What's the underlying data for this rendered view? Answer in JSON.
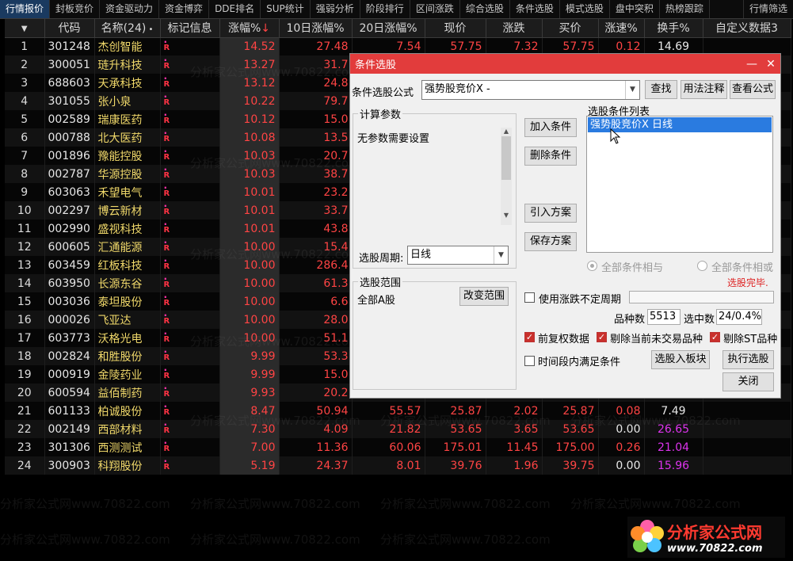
{
  "tabs": [
    "行情报价",
    "封板竞价",
    "资金驱动力",
    "资金博弈",
    "DDE排名",
    "SUP统计",
    "强弱分析",
    "阶段排行",
    "区间涨跌",
    "综合选股",
    "条件选股",
    "模式选股",
    "盘中突积",
    "热榜跟踪",
    "行情筛选"
  ],
  "columns": [
    "",
    "代码",
    "名称(24)",
    "标记信息",
    "涨幅%",
    "10日涨幅%",
    "20日涨幅%",
    "现价",
    "涨跌",
    "买价",
    "涨速%",
    "换手%",
    "自定义数据3"
  ],
  "sort_indicator": "↓",
  "rows": [
    {
      "n": "1",
      "code": "301248",
      "name": "杰创智能",
      "pct": "14.52",
      "d10": "27.48",
      "d20": "7.54",
      "price": "57.75",
      "chg": "7.32",
      "bid": "57.75",
      "spd": "0.12",
      "turn": "14.69",
      "spdc": "red",
      "turnc": "white"
    },
    {
      "n": "2",
      "code": "300051",
      "name": "琏升科技",
      "pct": "13.27",
      "d10": "31.7"
    },
    {
      "n": "3",
      "code": "688603",
      "name": "天承科技",
      "pct": "13.12",
      "d10": "24.8"
    },
    {
      "n": "4",
      "code": "301055",
      "name": "张小泉",
      "pct": "10.22",
      "d10": "79.7"
    },
    {
      "n": "5",
      "code": "002589",
      "name": "瑞康医药",
      "pct": "10.12",
      "d10": "15.0"
    },
    {
      "n": "6",
      "code": "000788",
      "name": "北大医药",
      "pct": "10.08",
      "d10": "13.5"
    },
    {
      "n": "7",
      "code": "001896",
      "name": "豫能控股",
      "pct": "10.03",
      "d10": "20.7"
    },
    {
      "n": "8",
      "code": "002787",
      "name": "华源控股",
      "pct": "10.03",
      "d10": "38.7"
    },
    {
      "n": "9",
      "code": "603063",
      "name": "禾望电气",
      "pct": "10.01",
      "d10": "23.2"
    },
    {
      "n": "10",
      "code": "002297",
      "name": "博云新材",
      "pct": "10.01",
      "d10": "33.7"
    },
    {
      "n": "11",
      "code": "002990",
      "name": "盛视科技",
      "pct": "10.01",
      "d10": "43.8"
    },
    {
      "n": "12",
      "code": "600605",
      "name": "汇通能源",
      "pct": "10.00",
      "d10": "15.4"
    },
    {
      "n": "13",
      "code": "603459",
      "name": "红板科技",
      "pct": "10.00",
      "d10": "286.4"
    },
    {
      "n": "14",
      "code": "603950",
      "name": "长源东谷",
      "pct": "10.00",
      "d10": "61.3"
    },
    {
      "n": "15",
      "code": "003036",
      "name": "泰坦股份",
      "pct": "10.00",
      "d10": "6.6"
    },
    {
      "n": "16",
      "code": "000026",
      "name": "飞亚达",
      "pct": "10.00",
      "d10": "28.0"
    },
    {
      "n": "17",
      "code": "603773",
      "name": "沃格光电",
      "pct": "10.00",
      "d10": "51.1"
    },
    {
      "n": "18",
      "code": "002824",
      "name": "和胜股份",
      "pct": "9.99",
      "d10": "53.3"
    },
    {
      "n": "19",
      "code": "000919",
      "name": "金陵药业",
      "pct": "9.99",
      "d10": "15.0"
    },
    {
      "n": "20",
      "code": "600594",
      "name": "益佰制药",
      "pct": "9.93",
      "d10": "20.2"
    },
    {
      "n": "21",
      "code": "601133",
      "name": "柏诚股份",
      "pct": "8.47",
      "d10": "50.94",
      "d20": "55.57",
      "price": "25.87",
      "chg": "2.02",
      "bid": "25.87",
      "spd": "0.08",
      "turn": "7.49",
      "spdc": "red",
      "turnc": "white"
    },
    {
      "n": "22",
      "code": "002149",
      "name": "西部材料",
      "pct": "7.30",
      "d10": "4.09",
      "d20": "21.82",
      "price": "53.65",
      "chg": "3.65",
      "bid": "53.65",
      "spd": "0.00",
      "turn": "26.65",
      "spdc": "white",
      "turnc": "mag"
    },
    {
      "n": "23",
      "code": "301306",
      "name": "西测测试",
      "pct": "7.00",
      "d10": "11.36",
      "d20": "60.06",
      "price": "175.01",
      "chg": "11.45",
      "bid": "175.00",
      "spd": "0.26",
      "turn": "21.04",
      "spdc": "red",
      "turnc": "mag"
    },
    {
      "n": "24",
      "code": "300903",
      "name": "科翔股份",
      "pct": "5.19",
      "d10": "24.37",
      "d20": "8.01",
      "price": "39.76",
      "chg": "1.96",
      "bid": "39.75",
      "spd": "0.00",
      "turn": "15.96",
      "spdc": "white",
      "turnc": "mag"
    }
  ],
  "dialog": {
    "title": "条件选股",
    "formula_label": "条件选股公式",
    "formula_value": "强势股竞价X  -",
    "btn_find": "查找",
    "btn_usage": "用法注释",
    "btn_view": "查看公式",
    "calc_params_title": "计算参数",
    "calc_params_text": "无参数需要设置",
    "btn_add": "加入条件",
    "btn_delete": "删除条件",
    "btn_import": "引入方案",
    "btn_save": "保存方案",
    "cond_list_title": "选股条件列表",
    "cond_item": "强势股竞价X  日线",
    "period_label": "选股周期:",
    "period_value": "日线",
    "radio_and": "全部条件相与",
    "radio_or": "全部条件相或",
    "status": "选股完毕.",
    "range_title": "选股范围",
    "range_value": "全部A股",
    "btn_change_range": "改变范围",
    "chk_uncertain": "使用涨跌不定周期",
    "count_label": "品种数",
    "count_value": "5513",
    "hit_label": "选中数",
    "hit_value": "24/0.4%",
    "chk_adjust": "前复权数据",
    "chk_remove_nontrade": "剔除当前未交易品种",
    "chk_remove_st": "剔除ST品种",
    "chk_period": "时间段内满足条件",
    "btn_to_block": "选股入板块",
    "btn_execute": "执行选股",
    "btn_close": "关闭"
  },
  "watermark": "分析家公式网www.70822.com",
  "logo": {
    "name": "分析家公式网",
    "url": "www.70822.com"
  }
}
